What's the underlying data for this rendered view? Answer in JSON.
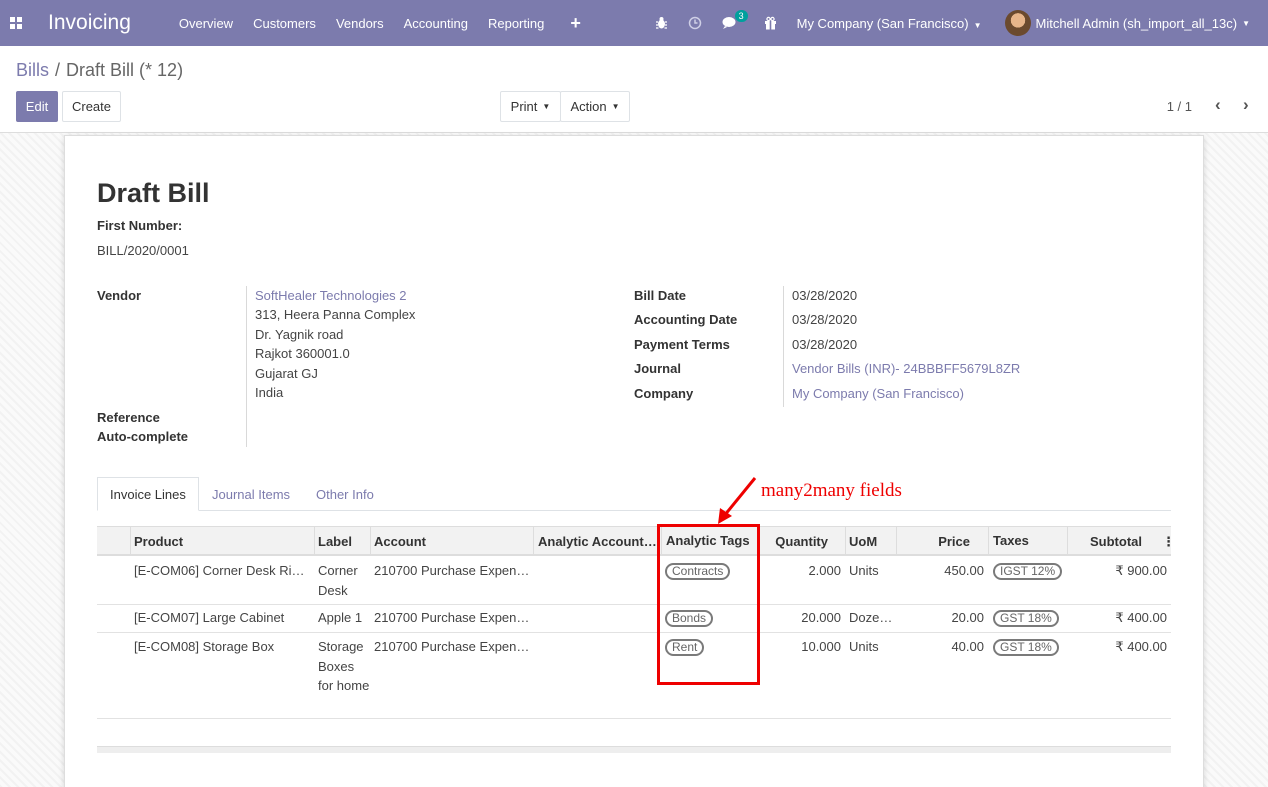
{
  "navbar": {
    "brand": "Invoicing",
    "menu": [
      "Overview",
      "Customers",
      "Vendors",
      "Accounting",
      "Reporting"
    ],
    "plus": "+",
    "messages_count": "3",
    "company": "My Company (San Francisco)",
    "user": "Mitchell Admin (sh_import_all_13c)",
    "bg_color": "#7c7bad"
  },
  "breadcrumb": {
    "parent": "Bills",
    "separator": "/",
    "current": "Draft Bill (* 12)"
  },
  "buttons": {
    "edit": "Edit",
    "create": "Create",
    "print": "Print",
    "action": "Action"
  },
  "pager": {
    "value": "1 / 1"
  },
  "form": {
    "title": "Draft Bill",
    "first_number_label": "First Number:",
    "first_number": "BILL/2020/0001",
    "vendor_label": "Vendor",
    "vendor_name": "SoftHealer Technologies 2",
    "vendor_address": [
      "313, Heera Panna Complex",
      "Dr. Yagnik road",
      "Rajkot 360001.0",
      "Gujarat GJ",
      "India"
    ],
    "reference_label": "Reference",
    "autocomplete_label": "Auto-complete",
    "bill_date_label": "Bill Date",
    "bill_date": "03/28/2020",
    "accounting_date_label": "Accounting Date",
    "accounting_date": "03/28/2020",
    "payment_terms_label": "Payment Terms",
    "payment_terms": "03/28/2020",
    "journal_label": "Journal",
    "journal": "Vendor Bills (INR)- 24BBBFF5679L8ZR",
    "company_label": "Company",
    "company": "My Company (San Francisco)"
  },
  "tabs": [
    "Invoice Lines",
    "Journal Items",
    "Other Info"
  ],
  "table": {
    "headers": {
      "product": "Product",
      "label": "Label",
      "account": "Account",
      "analytic_account": "Analytic Account…",
      "analytic_tags": "Analytic Tags",
      "quantity": "Quantity",
      "uom": "UoM",
      "price": "Price",
      "taxes": "Taxes",
      "subtotal": "Subtotal"
    },
    "rows": [
      {
        "product": "[E-COM06] Corner Desk Ri…",
        "label": "Corner Desk",
        "account": "210700 Purchase Expen…",
        "tag": "Contracts",
        "quantity": "2.000",
        "uom": "Units",
        "price": "450.00",
        "tax": "IGST 12%",
        "subtotal": "₹ 900.00"
      },
      {
        "product": "[E-COM07] Large Cabinet",
        "label": "Apple 1",
        "account": "210700 Purchase Expen…",
        "tag": "Bonds",
        "quantity": "20.000",
        "uom": "Doze…",
        "price": "20.00",
        "tax": "GST 18%",
        "subtotal": "₹ 400.00"
      },
      {
        "product": "[E-COM08] Storage Box",
        "label": "Storage Boxes for home",
        "account": "210700 Purchase Expen…",
        "tag": "Rent",
        "quantity": "10.000",
        "uom": "Units",
        "price": "40.00",
        "tax": "GST 18%",
        "subtotal": "₹ 400.00"
      }
    ]
  },
  "annotation": {
    "text": "many2many fields",
    "color": "#e00000"
  }
}
